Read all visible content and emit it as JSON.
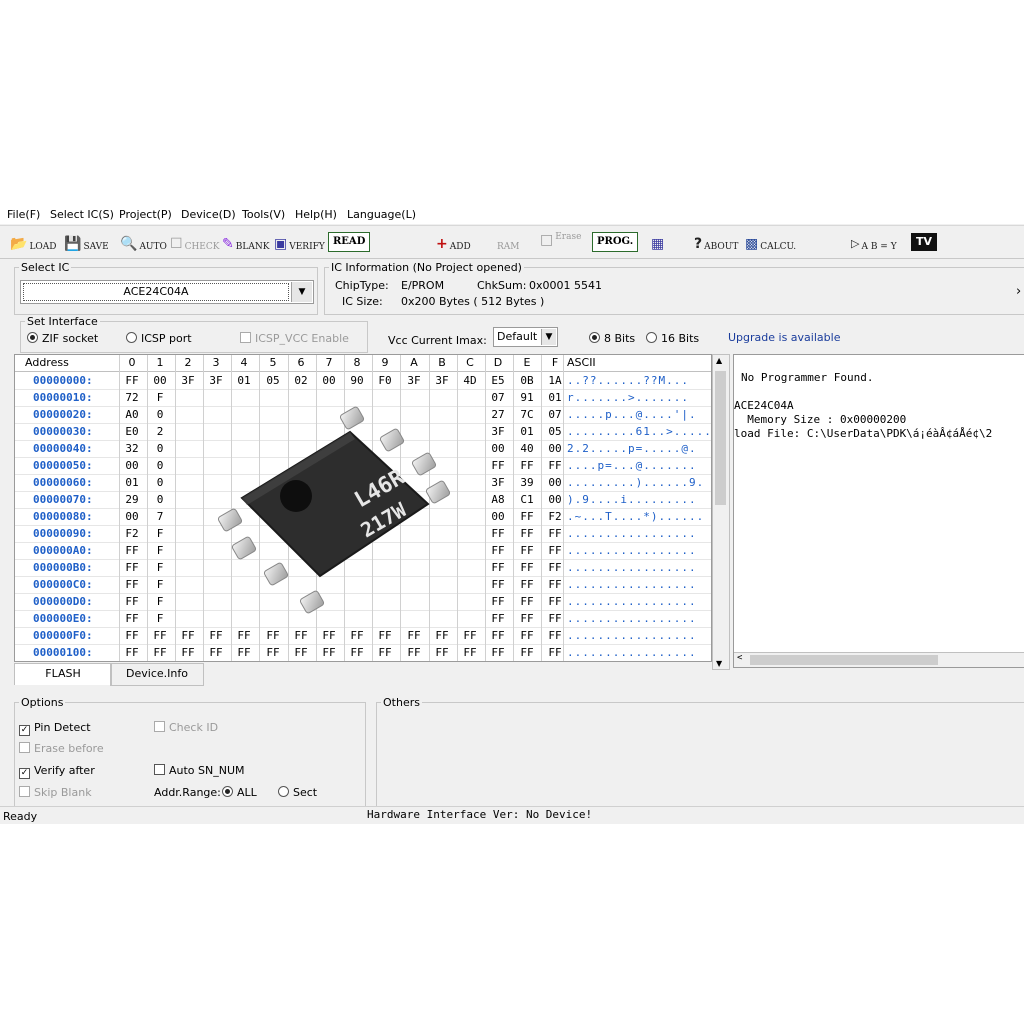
{
  "menu": [
    "File(F)",
    "Select IC(S)",
    "Project(P)",
    "Device(D)",
    "Tools(V)",
    "Help(H)",
    "Language(L)"
  ],
  "toolbar": {
    "load": "LOAD",
    "save": "SAVE",
    "auto": "AUTO",
    "check": "CHECK",
    "blank": "BLANK",
    "verify": "VERIFY",
    "read": "READ",
    "add": "ADD",
    "ram": "RAM",
    "erase": "Erase",
    "prog": "PROG.",
    "about": "ABOUT",
    "calcu": "CALCU.",
    "logic": "A B = Y",
    "tv": "TV"
  },
  "select_ic": {
    "legend": "Select IC",
    "value": "ACE24C04A"
  },
  "ic_info": {
    "legend": "IC Information (No Project opened)",
    "chip_type_label": "ChipType:",
    "chip_type": "E/PROM",
    "chksum_label": "ChkSum:",
    "chksum": "0x0001 5541",
    "ic_size_label": "IC Size:",
    "ic_size": "0x200 Bytes ( 512 Bytes )"
  },
  "interface": {
    "legend": "Set Interface",
    "zif": "ZIF socket",
    "icsp": "ICSP port",
    "icsp_vcc": "ICSP_VCC Enable",
    "vcc_label": "Vcc Current Imax:",
    "vcc_value": "Default",
    "bits8": "8 Bits",
    "bits16": "16 Bits",
    "upgrade": "Upgrade is available"
  },
  "hex": {
    "address_header": "Address",
    "columns": [
      "0",
      "1",
      "2",
      "3",
      "4",
      "5",
      "6",
      "7",
      "8",
      "9",
      "A",
      "B",
      "C",
      "D",
      "E",
      "F"
    ],
    "ascii_header": "ASCII",
    "rows": [
      {
        "addr": "00000000:",
        "left": [
          "FF",
          "00",
          "3F",
          "3F",
          "01",
          "05",
          "02",
          "00",
          "90",
          "F0",
          "3F",
          "3F",
          "4D"
        ],
        "right": [
          "E5",
          "0B",
          "1A"
        ],
        "ascii": "..??......??M..."
      },
      {
        "addr": "00000010:",
        "left": [
          "72",
          "F"
        ],
        "right": [
          "07",
          "91",
          "01"
        ],
        "ascii": "r.......>......."
      },
      {
        "addr": "00000020:",
        "left": [
          "A0",
          "0"
        ],
        "right": [
          "27",
          "7C",
          "07"
        ],
        "ascii": ".....p...@....'|."
      },
      {
        "addr": "00000030:",
        "left": [
          "E0",
          "2"
        ],
        "right": [
          "3F",
          "01",
          "05"
        ],
        "ascii": ".........61..>....."
      },
      {
        "addr": "00000040:",
        "left": [
          "32",
          "0"
        ],
        "right": [
          "00",
          "40",
          "00"
        ],
        "ascii": "2.2.....p=.....@."
      },
      {
        "addr": "00000050:",
        "left": [
          "00",
          "0"
        ],
        "right": [
          "FF",
          "FF",
          "FF"
        ],
        "ascii": "....p=...@......."
      },
      {
        "addr": "00000060:",
        "left": [
          "01",
          "0"
        ],
        "right": [
          "3F",
          "39",
          "00"
        ],
        "ascii": ".........)......9."
      },
      {
        "addr": "00000070:",
        "left": [
          "29",
          "0"
        ],
        "right": [
          "A8",
          "C1",
          "00"
        ],
        "ascii": ").9....i........."
      },
      {
        "addr": "00000080:",
        "left": [
          "00",
          "7"
        ],
        "right": [
          "00",
          "FF",
          "F2"
        ],
        "ascii": ".~...T....*)......"
      },
      {
        "addr": "00000090:",
        "left": [
          "F2",
          "F"
        ],
        "right": [
          "FF",
          "FF",
          "FF"
        ],
        "ascii": "................."
      },
      {
        "addr": "000000A0:",
        "left": [
          "FF",
          "F"
        ],
        "right": [
          "FF",
          "FF",
          "FF"
        ],
        "ascii": "................."
      },
      {
        "addr": "000000B0:",
        "left": [
          "FF",
          "F"
        ],
        "right": [
          "FF",
          "FF",
          "FF"
        ],
        "ascii": "................."
      },
      {
        "addr": "000000C0:",
        "left": [
          "FF",
          "F"
        ],
        "right": [
          "FF",
          "FF",
          "FF"
        ],
        "ascii": "................."
      },
      {
        "addr": "000000D0:",
        "left": [
          "FF",
          "F"
        ],
        "right": [
          "FF",
          "FF",
          "FF"
        ],
        "ascii": "................."
      },
      {
        "addr": "000000E0:",
        "left": [
          "FF",
          "F"
        ],
        "right": [
          "FF",
          "FF",
          "FF"
        ],
        "ascii": "................."
      },
      {
        "addr": "000000F0:",
        "left": [
          "FF",
          "FF",
          "FF",
          "FF",
          "FF",
          "FF",
          "FF",
          "FF",
          "FF",
          "FF",
          "FF",
          "FF",
          "FF"
        ],
        "right": [
          "FF",
          "FF",
          "FF"
        ],
        "ascii": "................."
      },
      {
        "addr": "00000100:",
        "left": [
          "FF",
          "FF",
          "FF",
          "FF",
          "FF",
          "FF",
          "FF",
          "FF",
          "FF",
          "FF",
          "FF",
          "FF",
          "FF"
        ],
        "right": [
          "FF",
          "FF",
          "FF"
        ],
        "ascii": "................."
      }
    ]
  },
  "chip": {
    "line1": "L46R",
    "line2": "217W"
  },
  "log": {
    "line1": "No Programmer Found.",
    "line2": "ACE24C04A",
    "line3": "  Memory Size : 0x00000200",
    "line4": "load File: C:\\UserData\\PDK\\á¡éàÂ¢áÅé¢\\2"
  },
  "tabs": {
    "flash": "FLASH",
    "device_info": "Device.Info"
  },
  "options": {
    "legend": "Options",
    "pin_detect": "Pin Detect",
    "check_id": "Check ID",
    "erase_before": "Erase before",
    "verify_after": "Verify after",
    "auto_sn": "Auto SN_NUM",
    "skip_blank": "Skip Blank",
    "addr_range": "Addr.Range:",
    "all": "ALL",
    "sect": "Sect"
  },
  "others": {
    "legend": "Others"
  },
  "status": {
    "left": "Ready",
    "center": "Hardware Interface Ver: No Device!"
  },
  "colors": {
    "address_blue": "#1e5fc8",
    "link_blue": "#1a3c9c",
    "read_border": "#2c6b2c"
  }
}
